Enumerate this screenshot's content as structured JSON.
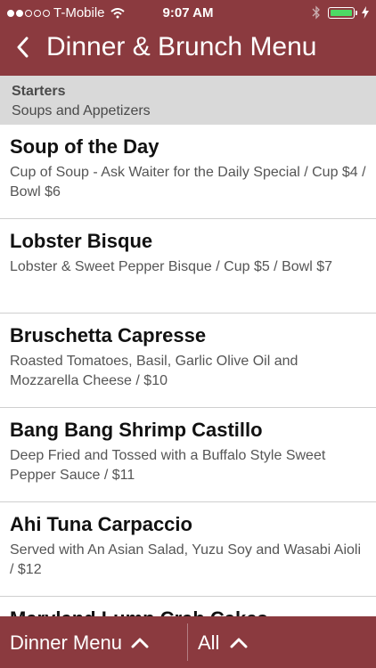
{
  "status_bar": {
    "carrier": "T-Mobile",
    "time": "9:07 AM",
    "signal_bars": 2,
    "battery_color": "#4cd964"
  },
  "nav": {
    "title": "Dinner & Brunch Menu",
    "back_icon": "chevron-left-icon"
  },
  "section": {
    "heading": "Starters",
    "subheading": "Soups and Appetizers"
  },
  "items": [
    {
      "name": "Soup of the Day",
      "desc": "Cup of Soup - Ask Waiter for the Daily Special / Cup $4 / Bowl $6"
    },
    {
      "name": "Lobster Bisque",
      "desc": "Lobster & Sweet Pepper Bisque / Cup $5 / Bowl $7"
    },
    {
      "name": "Bruschetta Capresse",
      "desc": "Roasted Tomatoes, Basil, Garlic Olive Oil and Mozzarella Cheese / $10"
    },
    {
      "name": "Bang Bang Shrimp Castillo",
      "desc": "Deep Fried and Tossed with a Buffalo Style Sweet Pepper Sauce / $11"
    },
    {
      "name": "Ahi Tuna Carpaccio",
      "desc": "Served with An Asian Salad, Yuzu Soy and Wasabi Aioli / $12"
    },
    {
      "name": "Maryland Lump Crab Cakes",
      "desc": ""
    }
  ],
  "bottom_bar": {
    "menu_label": "Dinner Menu",
    "filter_label": "All",
    "caret_icon": "chevron-up-icon"
  },
  "colors": {
    "brand": "#8b3a3f",
    "section_bg": "#d9d9d9"
  }
}
